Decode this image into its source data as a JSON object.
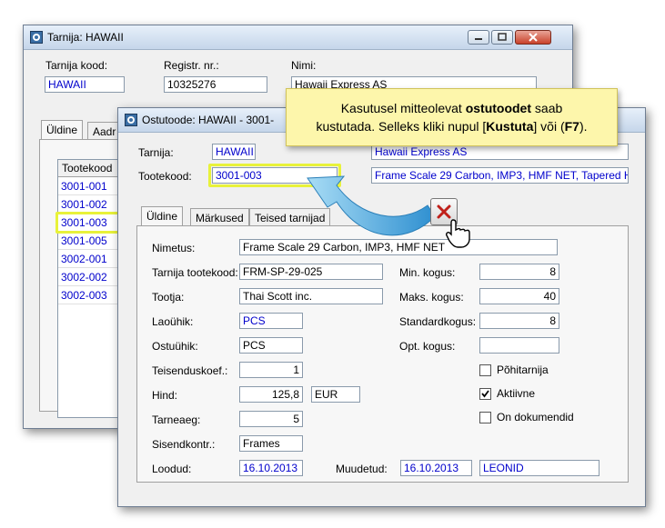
{
  "back_window": {
    "title": "Tarnija: HAWAII",
    "fields": {
      "supplier_code_label": "Tarnija kood:",
      "supplier_code_value": "HAWAII",
      "reg_no_label": "Registr. nr.:",
      "reg_no_value": "10325276",
      "name_label": "Nimi:",
      "name_value": "Hawaii Express AS"
    },
    "tabs": [
      "Üldine",
      "Aadr"
    ],
    "list": {
      "header": "Tootekood",
      "rows": [
        "3001-001",
        "3001-002",
        "3001-003",
        "3001-005",
        "3002-001",
        "3002-002",
        "3002-003"
      ]
    }
  },
  "front_window": {
    "title": "Ostutoode: HAWAII - 3001-",
    "supplier_label": "Tarnija:",
    "supplier_value": "HAWAII",
    "supplier_name": "Hawaii Express AS",
    "product_code_label": "Tootekood:",
    "product_code_value": "3001-003",
    "product_name_value": "Frame Scale 29 Carbon, IMP3, HMF NET, Tapered H",
    "tabs": [
      "Üldine",
      "Märkused",
      "Teised tarnijad"
    ],
    "form": {
      "name_label": "Nimetus:",
      "name_value": "Frame Scale 29 Carbon, IMP3, HMF NET",
      "supplier_code_label": "Tarnija tootekood:",
      "supplier_code_value": "FRM-SP-29-025",
      "maker_label": "Tootja:",
      "maker_value": "Thai Scott inc.",
      "stock_unit_label": "Laoühik:",
      "stock_unit_value": "PCS",
      "purchase_unit_label": "Ostuühik:",
      "purchase_unit_value": "PCS",
      "conv_label": "Teisenduskoef.:",
      "conv_value": "1",
      "price_label": "Hind:",
      "price_value": "125,8",
      "currency_value": "EUR",
      "lead_label": "Tarneaeg:",
      "lead_value": "5",
      "input_label": "Sisendkontr.:",
      "input_value": "Frames",
      "created_label": "Loodud:",
      "created_value": "16.10.2013",
      "modified_label": "Muudetud:",
      "modified_value": "16.10.2013",
      "modified_by": "LEONID",
      "min_label": "Min. kogus:",
      "min_value": "8",
      "max_label": "Maks. kogus:",
      "max_value": "40",
      "std_label": "Standardkogus:",
      "std_value": "8",
      "opt_label": "Opt. kogus:",
      "opt_value": "",
      "main_supplier_label": "Põhitarnija",
      "active_label": "Aktiivne",
      "on_docs_label": "On dokumendid"
    },
    "checkboxes": {
      "main_supplier": false,
      "active": true,
      "on_docs": false
    }
  },
  "callout": {
    "text_a": "Kasutusel mitteolevat ",
    "text_b": "ostutoodet",
    "text_c": " saab",
    "text_d": "kustutada. Selleks kliki nupul [",
    "text_e": "Kustuta",
    "text_f": "] või (",
    "text_g": "F7",
    "text_h": ")."
  },
  "colors": {
    "highlight": "#e8f23a",
    "callout_bg": "#fdf6ab",
    "link_blue": "#0000cc",
    "arrow": "#3a9fd8"
  }
}
